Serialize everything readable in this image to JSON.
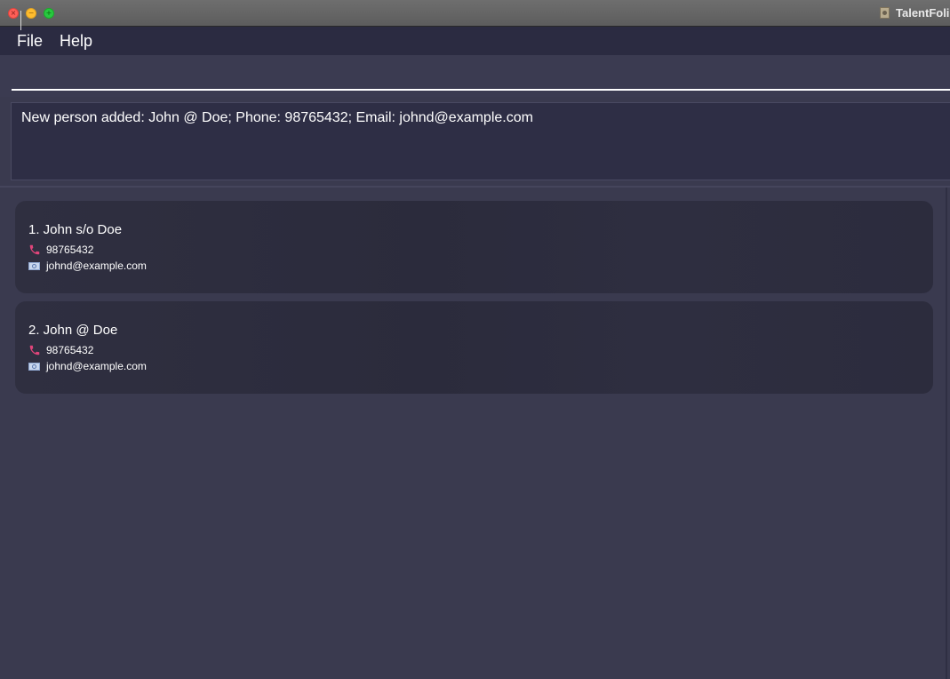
{
  "window": {
    "title": "TalentFoli"
  },
  "menu": {
    "items": [
      "File",
      "Help"
    ]
  },
  "command_box": {
    "value": "",
    "placeholder": ""
  },
  "result_display": {
    "text": "New person added: John  @ Doe; Phone: 98765432; Email: johnd@example.com"
  },
  "persons": [
    {
      "name": "1. John s/o Doe",
      "phone": "98765432",
      "email": "johnd@example.com"
    },
    {
      "name": "2. John  @ Doe",
      "phone": "98765432",
      "email": "johnd@example.com"
    }
  ],
  "icons": {
    "phone": "phone-icon",
    "email": "email-icon",
    "app": "app-document-icon"
  },
  "colors": {
    "background": "#3a3a4f",
    "menubar": "#2b2b41",
    "card": "#2d2d3e",
    "phone_icon": "#e0457a",
    "text": "#ffffff"
  }
}
